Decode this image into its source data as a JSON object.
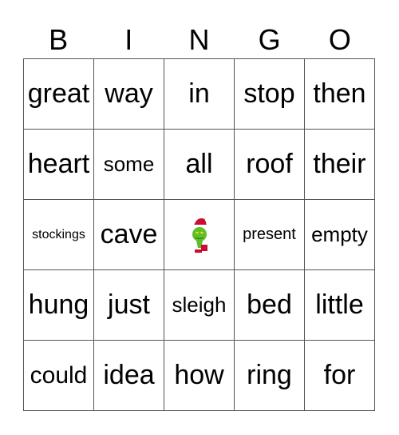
{
  "header": {
    "letters": [
      "B",
      "I",
      "N",
      "G",
      "O"
    ]
  },
  "grid": {
    "rows": [
      [
        "great",
        "way",
        "in",
        "stop",
        "then"
      ],
      [
        "heart",
        "some",
        "all",
        "roof",
        "their"
      ],
      [
        "stockings",
        "cave",
        "",
        "present",
        "empty"
      ],
      [
        "hung",
        "just",
        "sleigh",
        "bed",
        "little"
      ],
      [
        "could",
        "idea",
        "how",
        "ring",
        "for"
      ]
    ],
    "free_space": {
      "icon": "grinch-santa-hat-icon"
    }
  },
  "colors": {
    "grid_line": "#555555",
    "text": "#000000",
    "background": "#ffffff"
  }
}
